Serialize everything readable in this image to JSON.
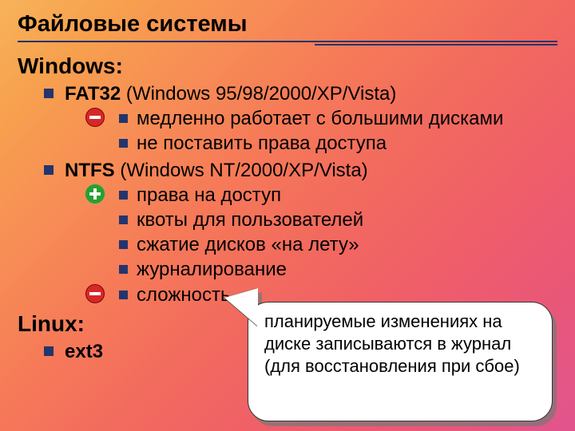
{
  "title": "Файловые системы",
  "sections": {
    "windows": {
      "heading": "Windows:",
      "items": [
        {
          "name": "FAT32",
          "suffix": " (Windows 95/98/2000/XP/Vista)",
          "sub": [
            {
              "text": "медленно работает с большими дисками",
              "badge": "minus"
            },
            {
              "text": "не поставить права доступа"
            }
          ]
        },
        {
          "name": "NTFS",
          "suffix": " (Windows NT/2000/XP/Vista)",
          "sub": [
            {
              "text": "права на доступ",
              "badge": "plus"
            },
            {
              "text": "квоты для пользователей"
            },
            {
              "text": "сжатие дисков «на лету»"
            },
            {
              "text": "журналирование"
            },
            {
              "text": "сложность",
              "badge": "minus"
            }
          ]
        }
      ]
    },
    "linux": {
      "heading": "Linux:",
      "items": [
        {
          "name": "ext3",
          "suffix": ""
        }
      ]
    }
  },
  "callout": "планируемые изменениях на диске записываются в журнал (для восстановления при сбое)"
}
